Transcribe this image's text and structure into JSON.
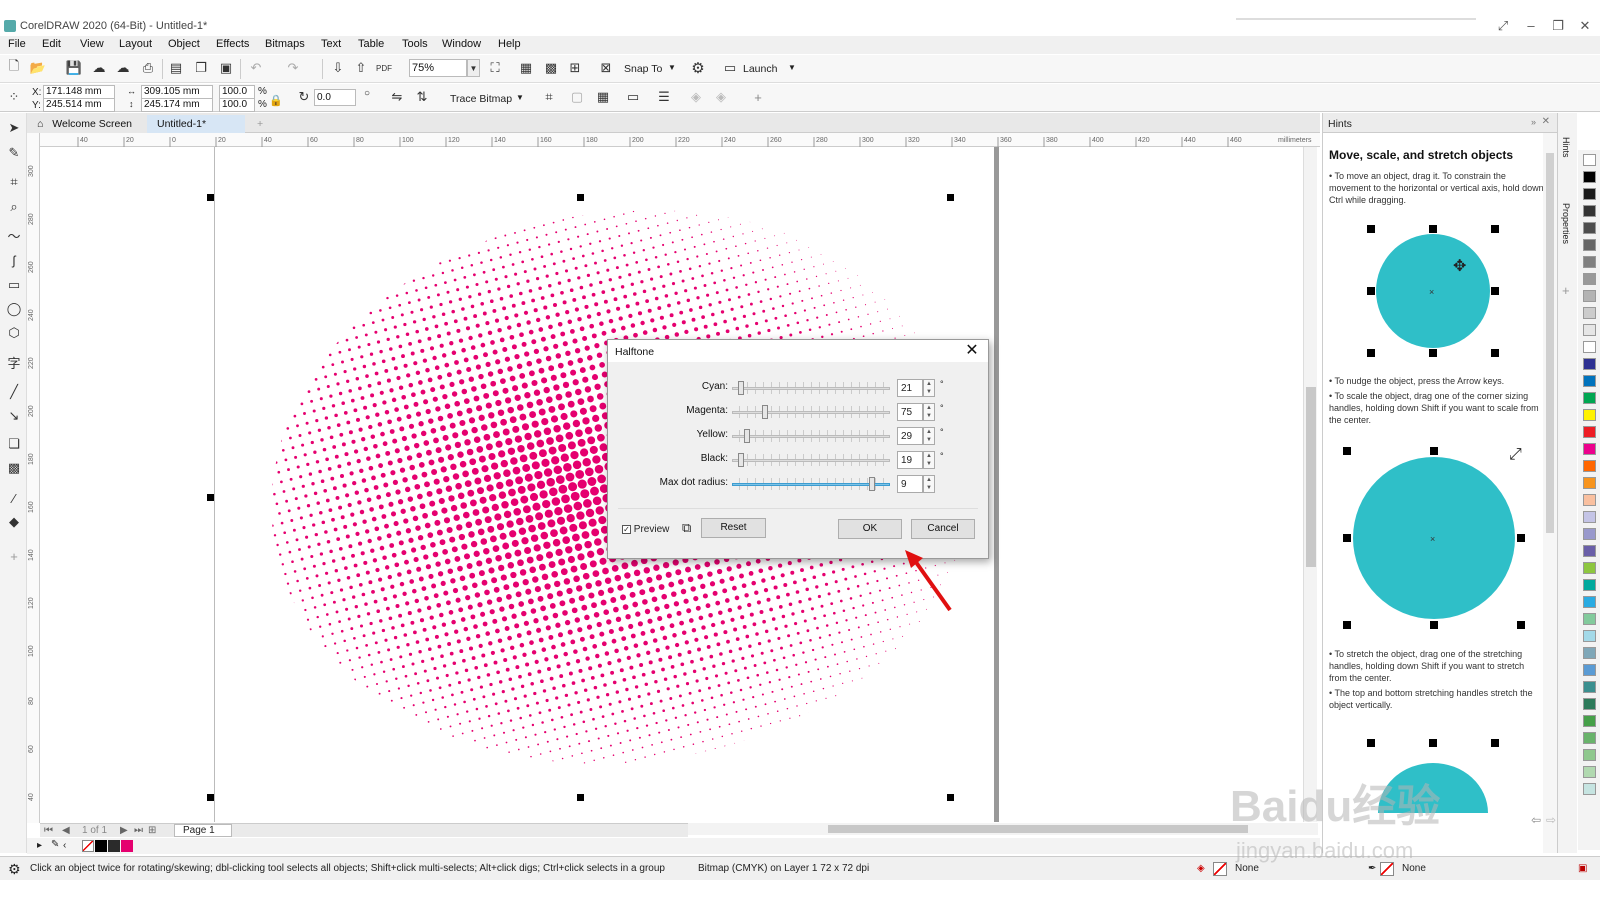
{
  "window": {
    "title": "CorelDRAW 2020 (64-Bit) - Untitled-1*"
  },
  "menu": [
    "File",
    "Edit",
    "View",
    "Layout",
    "Object",
    "Effects",
    "Bitmaps",
    "Text",
    "Table",
    "Tools",
    "Window",
    "Help"
  ],
  "toolbar1": {
    "zoom": "75%",
    "snap_to": "Snap To",
    "launch": "Launch"
  },
  "toolbar2": {
    "x_label": "X:",
    "x": "171.148 mm",
    "y_label": "Y:",
    "y": "245.514 mm",
    "width": "309.105 mm",
    "height": "245.174 mm",
    "scale_w": "100.0",
    "scale_h": "100.0",
    "pct1": "%",
    "pct2": "%",
    "angle": "0.0",
    "trace_bitmap": "Trace Bitmap"
  },
  "tabs": {
    "welcome": "Welcome Screen",
    "doc": "Untitled-1*"
  },
  "ruler": {
    "unit": "millimeters",
    "h_ticks": [
      "40",
      "20",
      "0",
      "20",
      "40",
      "60",
      "80",
      "100",
      "120",
      "140",
      "160",
      "180",
      "200",
      "220",
      "240",
      "260",
      "280",
      "300",
      "320",
      "340",
      "360",
      "380",
      "400",
      "420",
      "440",
      "460"
    ],
    "v_ticks": [
      "300",
      "280",
      "260",
      "240",
      "220",
      "200",
      "180",
      "160",
      "140",
      "120",
      "100",
      "80",
      "60",
      "40"
    ]
  },
  "page_nav": {
    "counter": "1 of 1",
    "page": "Page 1"
  },
  "status": {
    "hint": "Click an object twice for rotating/skewing; dbl-clicking tool selects all objects; Shift+click multi-selects; Alt+click digs; Ctrl+click selects in a group",
    "object_info": "Bitmap (CMYK) on Layer 1 72 x 72 dpi",
    "fill": "None",
    "outline": "None"
  },
  "dialog": {
    "title": "Halftone",
    "rows": [
      {
        "label": "Cyan:",
        "value": "21",
        "level": 0.04,
        "unit": "°"
      },
      {
        "label": "Magenta:",
        "value": "75",
        "level": 0.2,
        "unit": "°"
      },
      {
        "label": "Yellow:",
        "value": "29",
        "level": 0.08,
        "unit": "°"
      },
      {
        "label": "Black:",
        "value": "19",
        "level": 0.04,
        "unit": "°"
      },
      {
        "label": "Max dot radius:",
        "value": "9",
        "level": 0.9,
        "unit": ""
      }
    ],
    "preview_label": "Preview",
    "reset": "Reset",
    "ok": "OK",
    "cancel": "Cancel"
  },
  "hints": {
    "panel": "Hints",
    "title": "Move, scale, and stretch objects",
    "p1": "• To move an object, drag it. To constrain the movement to the horizontal or vertical axis, hold down Ctrl while dragging.",
    "p2": "• To nudge the object, press the Arrow keys.",
    "p3": "• To scale the object, drag one of the corner sizing handles, holding down Shift if you want to scale from the center.",
    "p4": "• To stretch the object, drag one of the stretching handles, holding down Shift if you want to stretch from the center.",
    "p5": "• The top and bottom stretching handles stretch the object vertically."
  },
  "dockers": [
    "Hints",
    "Properties"
  ],
  "watermark": {
    "logo": "Baidu经验",
    "url": "jingyan.baidu.com"
  },
  "colors": {
    "halftone": "#e5006f",
    "hint_circle": "#2fbfc8",
    "palette": [
      "#ffffff",
      "#000000",
      "#1a1a1a",
      "#333333",
      "#4d4d4d",
      "#666666",
      "#808080",
      "#999999",
      "#b3b3b3",
      "#cccccc",
      "#e6e6e6",
      "#ffffff",
      "#2e3192",
      "#0072bc",
      "#00a651",
      "#fff200",
      "#ed1c24",
      "#ec008c",
      "#ff6600",
      "#f7941d",
      "#f9c0a0",
      "#c4c4e6",
      "#9999cc",
      "#6a5fa8",
      "#8dc63f",
      "#00a99d",
      "#29abe2",
      "#82ca9c",
      "#a3d9e8",
      "#7fa7b8",
      "#5a9bd4",
      "#3a8f8f",
      "#2d7a5a",
      "#46a049",
      "#69b36b",
      "#8fc88e",
      "#b1d9b0",
      "#c6e4e1"
    ]
  }
}
